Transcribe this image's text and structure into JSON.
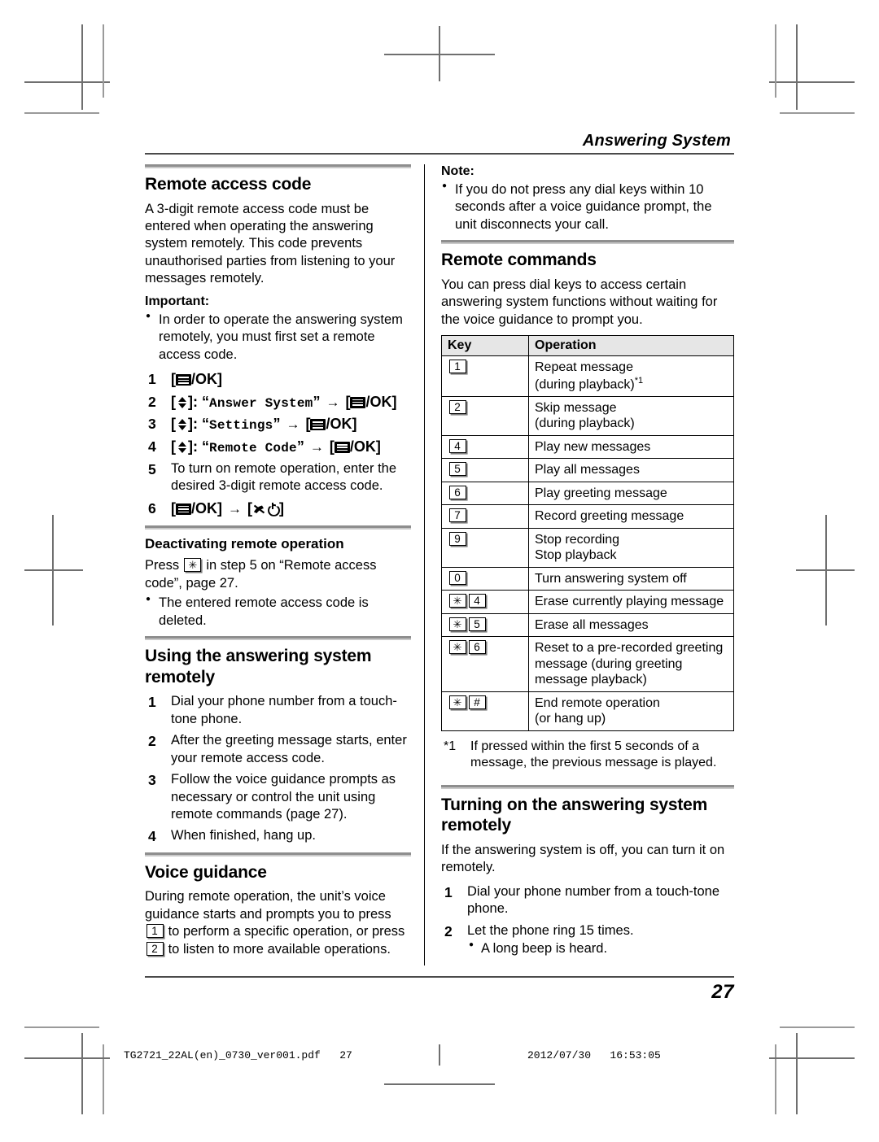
{
  "header": {
    "running_head": "Answering System",
    "page_number": "27"
  },
  "printer_footer": {
    "filename": "TG2721_22AL(en)_0730_ver001.pdf",
    "page": "27",
    "date": "2012/07/30",
    "time": "16:53:05"
  },
  "left_column": {
    "section1": {
      "heading": "Remote access code",
      "intro": "A 3-digit remote access code must be entered when operating the answering system remotely. This code prevents unauthorised parties from listening to your messages remotely.",
      "important_label": "Important:",
      "important_bullets": [
        "In order to operate the answering system remotely, you must first set a remote access code."
      ],
      "steps": [
        {
          "type": "key",
          "prefix": "",
          "menu": true,
          "ok_label": "/OK"
        },
        {
          "type": "nav",
          "quoted": "Answer System"
        },
        {
          "type": "nav",
          "quoted": "Settings"
        },
        {
          "type": "nav",
          "quoted": "Remote Code"
        },
        {
          "type": "text",
          "text": "To turn on remote operation, enter the desired 3-digit remote access code."
        },
        {
          "type": "final",
          "ok_label": "/OK"
        }
      ]
    },
    "section2": {
      "heading": "Deactivating remote operation",
      "text_before_key": "Press",
      "key_glyph": "asterisk",
      "text_after_key": "in step 5 on “Remote access code”, page 27.",
      "bullets": [
        "The entered remote access code is deleted."
      ]
    },
    "section3": {
      "heading": "Using the answering system remotely",
      "steps": [
        "Dial your phone number from a touch-tone phone.",
        "After the greeting message starts, enter your remote access code.",
        "Follow the voice guidance prompts as necessary or control the unit using remote commands (page 27).",
        "When finished, hang up."
      ]
    },
    "section4": {
      "heading": "Voice guidance",
      "text_part1": "During remote operation, the unit’s voice guidance starts and prompts you to press",
      "key1": "1",
      "text_part2": "to perform a specific operation, or press",
      "key2": "2",
      "text_part3": "to listen to more available operations."
    }
  },
  "right_column": {
    "note": {
      "label": "Note:",
      "bullets": [
        "If you do not press any dial keys within 10 seconds after a voice guidance prompt, the unit disconnects your call."
      ]
    },
    "section1": {
      "heading": "Remote commands",
      "intro": "You can press dial keys to access certain answering system functions without waiting for the voice guidance to prompt you.",
      "table": {
        "headers": [
          "Key",
          "Operation"
        ],
        "rows": [
          {
            "keys": [
              "1"
            ],
            "operation": "Repeat message\n(during playback)",
            "footnote_mark": "*1"
          },
          {
            "keys": [
              "2"
            ],
            "operation": "Skip message\n(during playback)",
            "footnote_mark": ""
          },
          {
            "keys": [
              "4"
            ],
            "operation": "Play new messages",
            "footnote_mark": ""
          },
          {
            "keys": [
              "5"
            ],
            "operation": "Play all messages",
            "footnote_mark": ""
          },
          {
            "keys": [
              "6"
            ],
            "operation": "Play greeting message",
            "footnote_mark": ""
          },
          {
            "keys": [
              "7"
            ],
            "operation": "Record greeting message",
            "footnote_mark": ""
          },
          {
            "keys": [
              "9"
            ],
            "operation": "Stop recording\nStop playback",
            "footnote_mark": ""
          },
          {
            "keys": [
              "0"
            ],
            "operation": "Turn answering system off",
            "footnote_mark": ""
          },
          {
            "keys": [
              "✳",
              "4"
            ],
            "operation": "Erase currently playing message",
            "footnote_mark": ""
          },
          {
            "keys": [
              "✳",
              "5"
            ],
            "operation": "Erase all messages",
            "footnote_mark": ""
          },
          {
            "keys": [
              "✳",
              "6"
            ],
            "operation": "Reset to a pre-recorded greeting message (during greeting message playback)",
            "footnote_mark": ""
          },
          {
            "keys": [
              "✳",
              "#"
            ],
            "operation": "End remote operation\n(or hang up)",
            "footnote_mark": ""
          }
        ]
      },
      "footnote": {
        "mark": "*1",
        "text": "If pressed within the first 5 seconds of a message, the previous message is played."
      }
    },
    "section2": {
      "heading": "Turning on the answering system remotely",
      "intro": "If the answering system is off, you can turn it on remotely.",
      "steps": [
        {
          "text": "Dial your phone number from a touch-tone phone.",
          "sub": []
        },
        {
          "text": "Let the phone ring 15 times.",
          "sub": [
            "A long beep is heard."
          ]
        }
      ]
    }
  },
  "labels": {
    "ok_suffix": "/OK",
    "arrow": "→",
    "quote_open": "“",
    "quote_close": "”",
    "colon": ":"
  }
}
